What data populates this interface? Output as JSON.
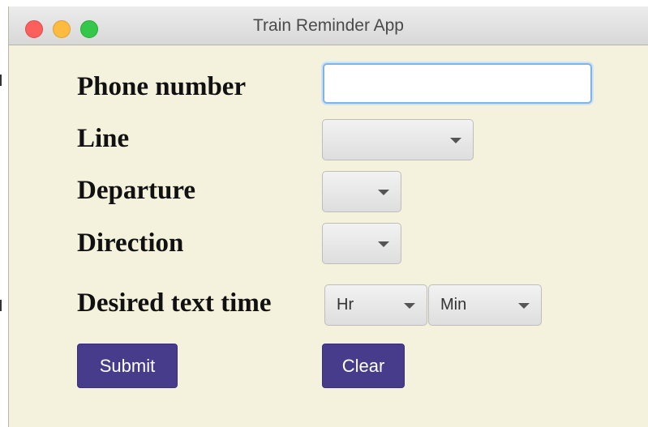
{
  "window": {
    "title": "Train Reminder App"
  },
  "form": {
    "phone_label": "Phone number",
    "phone_value": "",
    "line_label": "Line",
    "line_value": "",
    "departure_label": "Departure",
    "departure_value": "",
    "direction_label": "Direction",
    "direction_value": "",
    "time_label": "Desired text time",
    "hour_value": "Hr",
    "minute_value": "Min"
  },
  "buttons": {
    "submit": "Submit",
    "clear": "Clear"
  },
  "colors": {
    "background": "#f4f2dd",
    "button": "#473b8c",
    "focus_ring": "#7fb4e6"
  },
  "icons": {
    "dropdown": "chevron-down-icon"
  }
}
